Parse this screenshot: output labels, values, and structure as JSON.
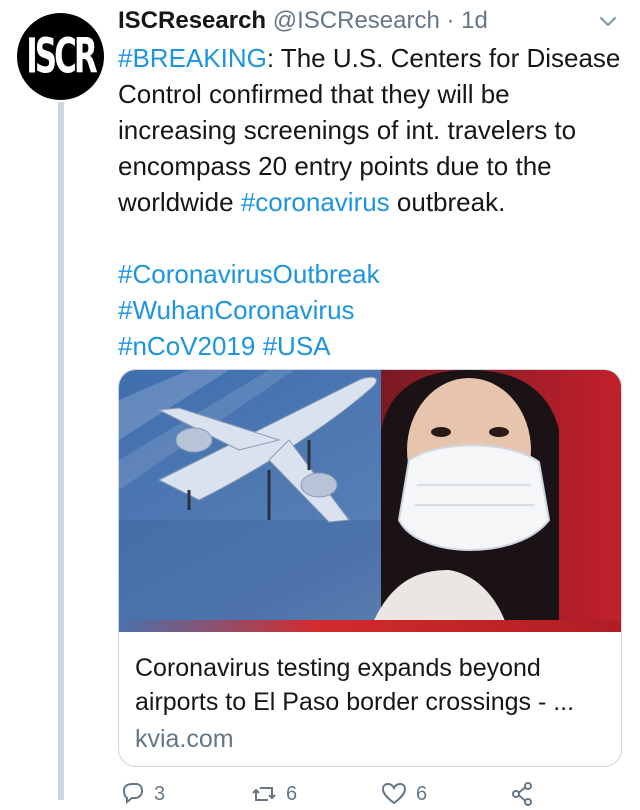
{
  "tweet": {
    "avatar_text": "ISCR",
    "display_name": "ISCResearch",
    "handle": "@ISCResearch",
    "separator": " · ",
    "time": "1d",
    "lines": [
      [
        {
          "t": "#BREAKING",
          "tag": true
        },
        {
          "t": ": The U.S. Centers for Disease"
        }
      ],
      [
        {
          "t": "Control confirmed that they will be"
        }
      ],
      [
        {
          "t": "increasing screenings of int. travelers to"
        }
      ],
      [
        {
          "t": "encompass 20 entry points due to the"
        }
      ],
      [
        {
          "t": "worldwide "
        },
        {
          "t": "#coronavirus",
          "tag": true
        },
        {
          "t": " outbreak."
        }
      ],
      [
        {
          "t": ""
        }
      ],
      [
        {
          "t": "#CoronavirusOutbreak",
          "tag": true
        }
      ],
      [
        {
          "t": "#WuhanCoronavirus",
          "tag": true
        }
      ],
      [
        {
          "t": "#nCoV2019",
          "tag": true
        },
        {
          "t": " "
        },
        {
          "t": "#USA",
          "tag": true
        }
      ]
    ]
  },
  "card": {
    "title_line1": "Coronavirus testing expands beyond",
    "title_line2": "airports to El Paso border crossings - ...",
    "domain": "kvia.com"
  },
  "actions": {
    "reply_count": "3",
    "retweet_count": "6",
    "like_count": "6"
  },
  "colors": {
    "link": "#1b95e0",
    "text": "#14171a",
    "secondary": "#657786",
    "border": "#ccd6dd"
  },
  "icons": [
    "chevron-down-icon",
    "reply-icon",
    "retweet-icon",
    "like-icon",
    "share-icon"
  ]
}
